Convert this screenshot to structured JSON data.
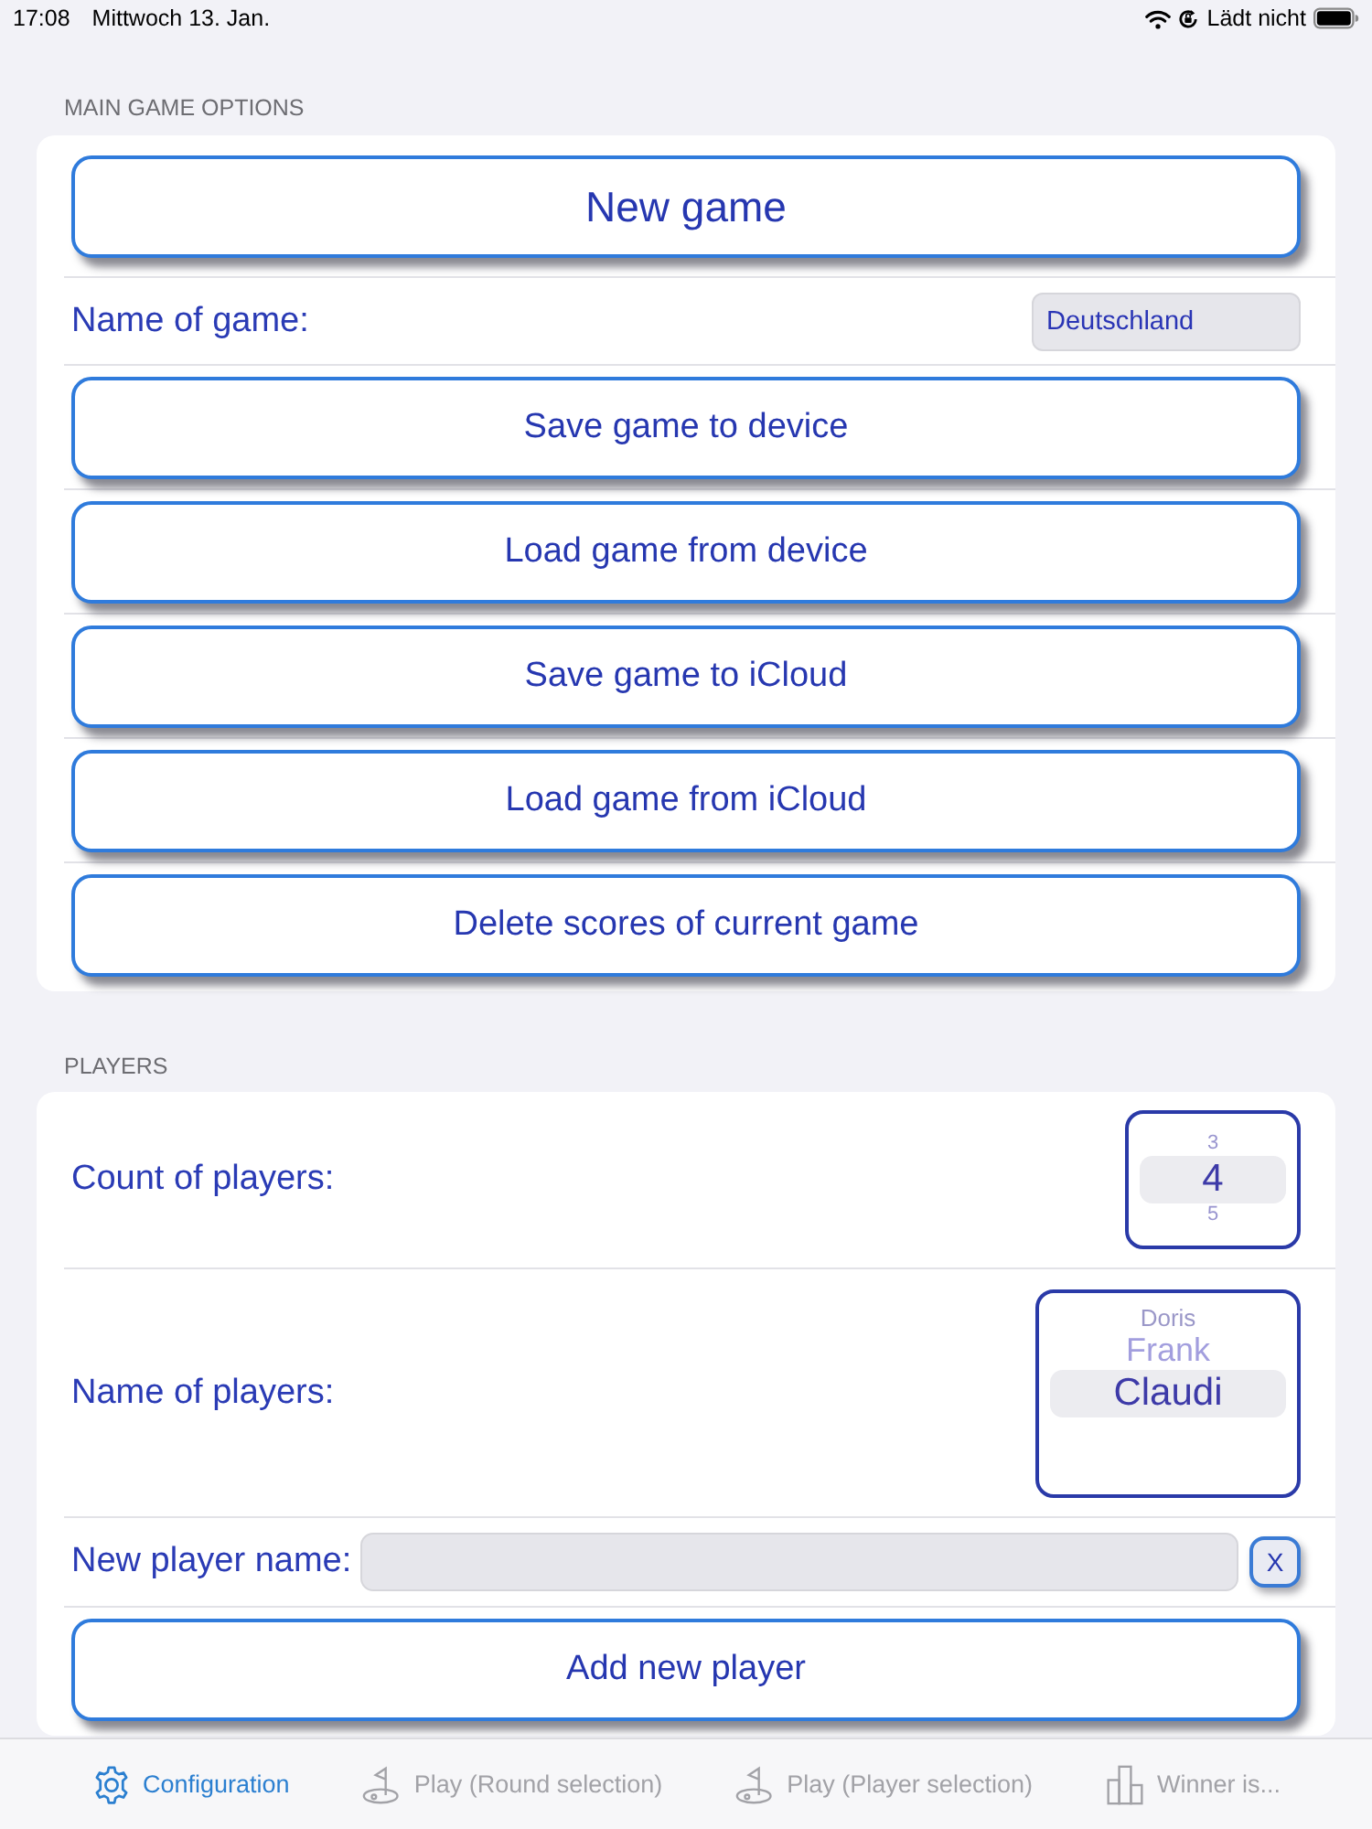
{
  "status_bar": {
    "time": "17:08",
    "date": "Mittwoch 13. Jan.",
    "charging": "Lädt nicht"
  },
  "sections": [
    {
      "header": "MAIN GAME OPTIONS",
      "rows": [
        {
          "kind": "large-button",
          "label": "New game"
        },
        {
          "kind": "text-field",
          "label": "Name of game:",
          "value": "Deutschland"
        },
        {
          "kind": "button",
          "label": "Save game to device"
        },
        {
          "kind": "button",
          "label": "Load game from device"
        },
        {
          "kind": "button",
          "label": "Save game to iCloud"
        },
        {
          "kind": "button",
          "label": "Load game from iCloud"
        },
        {
          "kind": "button",
          "label": "Delete scores of current game"
        }
      ]
    },
    {
      "header": "PLAYERS",
      "rows": [
        {
          "kind": "number-picker",
          "label": "Count of players:",
          "options": [
            {
              "text": "3",
              "selected": false
            },
            {
              "text": "4",
              "selected": true
            },
            {
              "text": "5",
              "selected": false
            }
          ]
        },
        {
          "kind": "name-picker",
          "label": "Name of players:",
          "options": [
            {
              "text": "Doris",
              "selected": false
            },
            {
              "text": "Frank",
              "selected": false
            },
            {
              "text": "Claudi",
              "selected": true
            }
          ]
        },
        {
          "kind": "input-with-clear",
          "label": "New player name:",
          "clear_label": "X"
        },
        {
          "kind": "button",
          "label": "Add new player"
        }
      ]
    }
  ],
  "tabs": [
    {
      "label": "Configuration",
      "selected": true
    },
    {
      "label": "Play (Round selection)",
      "selected": false
    },
    {
      "label": "Play (Player selection)",
      "selected": false
    },
    {
      "label": "Winner is...",
      "selected": false
    }
  ]
}
